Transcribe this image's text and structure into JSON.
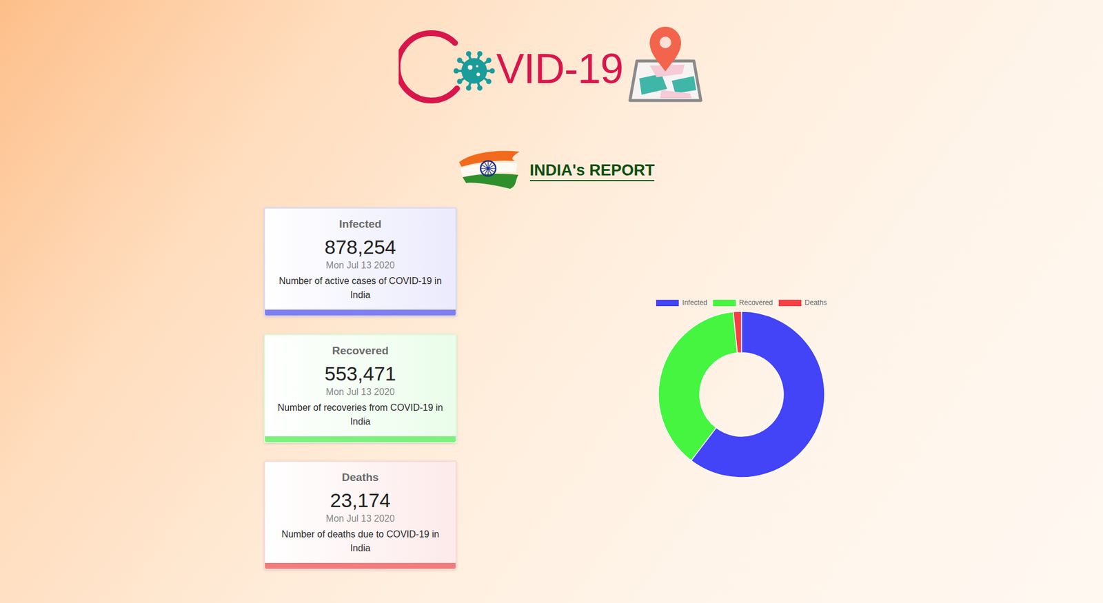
{
  "logo": {
    "text": "VID-19"
  },
  "report": {
    "title": "INDIA's REPORT"
  },
  "cards": [
    {
      "title": "Infected",
      "value": "878,254",
      "date": "Mon Jul 13 2020",
      "description": "Number of active cases of COVID-19 in India",
      "color": "#7f7ff2"
    },
    {
      "title": "Recovered",
      "value": "553,471",
      "date": "Mon Jul 13 2020",
      "description": "Number of recoveries from COVID-19 in India",
      "color": "#7cf27c"
    },
    {
      "title": "Deaths",
      "value": "23,174",
      "date": "Mon Jul 13 2020",
      "description": "Number of deaths due to COVID-19 in India",
      "color": "#f27c7c"
    }
  ],
  "chart": {
    "type": "doughnut",
    "slices": [
      {
        "label": "Infected",
        "value": 878254,
        "color": "#4343f7"
      },
      {
        "label": "Recovered",
        "value": 553471,
        "color": "#45f53f"
      },
      {
        "label": "Deaths",
        "value": 23174,
        "color": "#f53f45"
      }
    ]
  }
}
